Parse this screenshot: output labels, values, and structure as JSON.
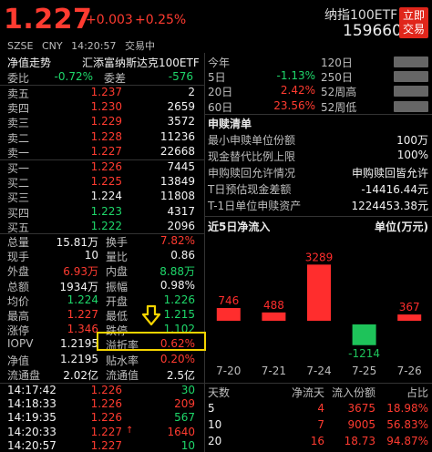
{
  "header": {
    "price": "1.227",
    "change": "+0.003",
    "change_pct": "+0.25%",
    "exchange": "SZSE",
    "currency": "CNY",
    "time": "14:20:57",
    "status": "交易中",
    "name": "纳指100ETF",
    "code": "159660",
    "trade_button": "立即交易"
  },
  "left": {
    "title_label": "净值走势",
    "fund_name": "汇添富纳斯达克100ETF",
    "wb_label": "委比",
    "wb_value": "-0.72%",
    "wc_label": "委差",
    "wc_value": "-576",
    "asks": [
      {
        "label": "卖五",
        "price": "1.237",
        "vol": "2"
      },
      {
        "label": "卖四",
        "price": "1.230",
        "vol": "2659"
      },
      {
        "label": "卖三",
        "price": "1.229",
        "vol": "3572"
      },
      {
        "label": "卖二",
        "price": "1.228",
        "vol": "11236"
      },
      {
        "label": "卖一",
        "price": "1.227",
        "vol": "22668"
      }
    ],
    "bids": [
      {
        "label": "买一",
        "price": "1.226",
        "vol": "7445"
      },
      {
        "label": "买二",
        "price": "1.225",
        "vol": "13849"
      },
      {
        "label": "买三",
        "price": "1.224",
        "vol": "11808"
      },
      {
        "label": "买四",
        "price": "1.223",
        "vol": "4317"
      },
      {
        "label": "买五",
        "price": "1.222",
        "vol": "2096"
      }
    ],
    "stats": [
      {
        "l1": "总量",
        "v1": "15.81万",
        "l2": "换手",
        "v2": "7.82%"
      },
      {
        "l1": "现手",
        "v1": "10",
        "l2": "量比",
        "v2": "0.86"
      },
      {
        "l1": "外盘",
        "v1": "6.93万",
        "l2": "内盘",
        "v2": "8.88万"
      },
      {
        "l1": "总额",
        "v1": "1934万",
        "l2": "振幅",
        "v2": "0.98%"
      },
      {
        "l1": "均价",
        "v1": "1.224",
        "l2": "开盘",
        "v2": "1.226"
      },
      {
        "l1": "最高",
        "v1": "1.227",
        "l2": "最低",
        "v2": "1.215"
      },
      {
        "l1": "涨停",
        "v1": "1.346",
        "l2": "跌停",
        "v2": "1.102"
      },
      {
        "l1": "IOPV",
        "v1": "1.2195",
        "l2": "溢折率",
        "v2": "0.62%"
      },
      {
        "l1": "净值",
        "v1": "1.2195",
        "l2": "贴水率",
        "v2": "0.20%"
      },
      {
        "l1": "流通盘",
        "v1": "2.02亿",
        "l2": "流通值",
        "v2": "2.5亿"
      }
    ],
    "ticks": [
      {
        "t": "14:17:42",
        "p": "1.226",
        "v": "30"
      },
      {
        "t": "14:18:33",
        "p": "1.226",
        "v": "209"
      },
      {
        "t": "14:19:35",
        "p": "1.226",
        "v": "567"
      },
      {
        "t": "14:20:33",
        "p": "1.227",
        "v": "1640",
        "up": true
      },
      {
        "t": "14:20:57",
        "p": "1.227",
        "v": "10"
      }
    ]
  },
  "right": {
    "returns": [
      {
        "l1": "今年",
        "v1": "",
        "l2": "120日",
        "v2": ""
      },
      {
        "l1": "5日",
        "v1": "-1.13%",
        "l2": "250日",
        "v2": ""
      },
      {
        "l1": "20日",
        "v1": "2.42%",
        "l2": "52周高",
        "v2": ""
      },
      {
        "l1": "60日",
        "v1": "23.56%",
        "l2": "52周低",
        "v2": ""
      }
    ],
    "sr_title": "申赎清单",
    "sr_rows": [
      {
        "k": "最小申赎单位份额",
        "v": "100万"
      },
      {
        "k": "现金替代比例上限",
        "v": "100%"
      },
      {
        "k": "申购赎回允许情况",
        "v": "申购赎回皆允许"
      },
      {
        "k": "T日预估现金差额",
        "v": "-14416.44元"
      },
      {
        "k": "T-1日单位申赎资产",
        "v": "1224453.38元"
      }
    ],
    "flow_title": "近5日净流入",
    "flow_unit": "单位(万元)",
    "table_head": {
      "days": "天数",
      "inflow": "净流天",
      "amount": "流入份额",
      "ratio": "占比"
    },
    "table": [
      {
        "d": "5",
        "n": "4",
        "a": "3675",
        "r": "18.98%"
      },
      {
        "d": "10",
        "n": "7",
        "a": "9005",
        "r": "56.83%"
      },
      {
        "d": "20",
        "n": "16",
        "a": "18.73",
        "r": "94.87%"
      }
    ]
  },
  "chart_data": {
    "type": "bar",
    "title": "近5日净流入",
    "ylabel": "单位(万元)",
    "categories": [
      "7-20",
      "7-21",
      "7-24",
      "7-25",
      "7-26"
    ],
    "values": [
      746,
      488,
      3289,
      -1214,
      367
    ],
    "colors": {
      "positive": "#ff2d2d",
      "negative": "#1ec35a"
    }
  }
}
